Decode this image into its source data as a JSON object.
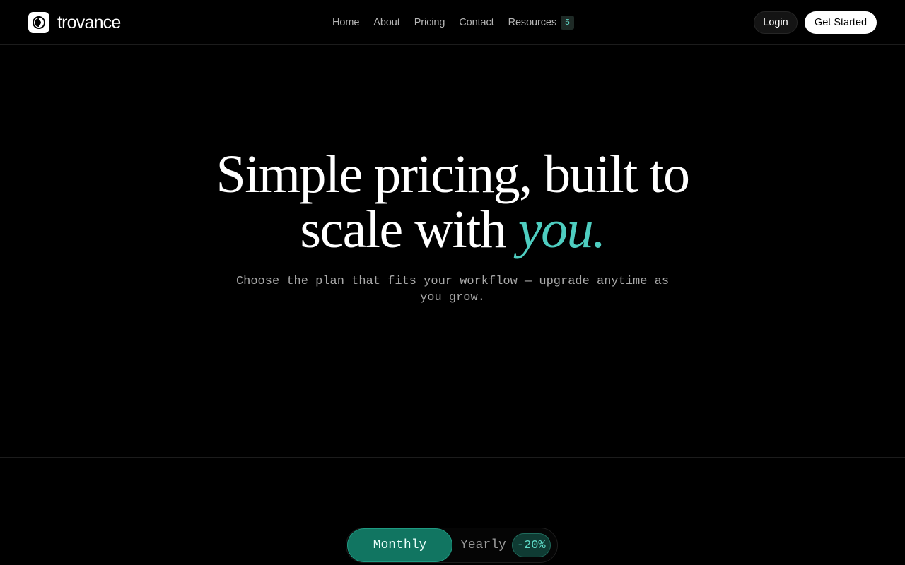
{
  "brand": {
    "name": "trovance",
    "logo_icon": "circle-half-icon"
  },
  "nav": {
    "items": [
      "Home",
      "About",
      "Pricing",
      "Contact",
      "Resources"
    ],
    "resources_badge": "5"
  },
  "header_actions": {
    "login": "Login",
    "get_started": "Get Started"
  },
  "hero": {
    "title_line1": "Simple pricing, built to",
    "title_line2_lead": "scale with ",
    "title_accent": "you.",
    "subtitle": "Choose the plan that fits your workflow — upgrade anytime as you grow."
  },
  "billing_toggle": {
    "monthly": "Monthly",
    "yearly": "Yearly",
    "yearly_discount": "-20%",
    "selected": "Monthly"
  },
  "colors": {
    "accent": "#4ecdc0",
    "toggle_active": "#117561",
    "background": "#000000"
  }
}
